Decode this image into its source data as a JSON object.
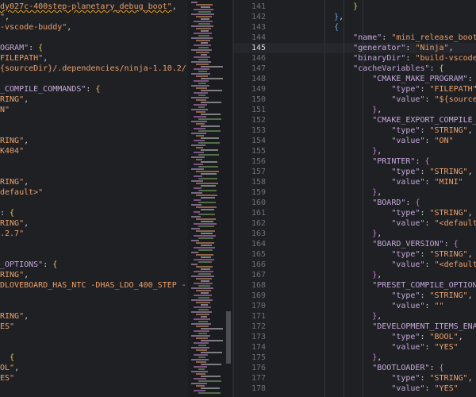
{
  "left_editor": {
    "lines": [
      [
        [
          "s",
          "dy027c-400step-planetary_debug_boot\""
        ],
        [
          "p",
          ","
        ]
      ],
      [
        [
          "s",
          "\""
        ],
        [
          "p",
          ","
        ]
      ],
      [
        [
          "s",
          "-vscode-buddy\""
        ],
        [
          "p",
          ","
        ]
      ],
      [],
      [
        [
          "k",
          "OGRAM\""
        ],
        [
          "p",
          ": "
        ],
        [
          "b1",
          "{"
        ]
      ],
      [
        [
          "s",
          "FILEPATH\""
        ],
        [
          "p",
          ","
        ]
      ],
      [
        [
          "s",
          "{sourceDir}/.dependencies/ninja-1.10.2/"
        ]
      ],
      [],
      [
        [
          "k",
          "_COMPILE_COMMANDS\""
        ],
        [
          "p",
          ": "
        ],
        [
          "b1",
          "{"
        ]
      ],
      [
        [
          "s",
          "RING\""
        ],
        [
          "p",
          ","
        ]
      ],
      [
        [
          "s",
          "N\""
        ]
      ],
      [],
      [],
      [
        [
          "s",
          "RING\""
        ],
        [
          "p",
          ","
        ]
      ],
      [
        [
          "s",
          "K404\""
        ]
      ],
      [],
      [],
      [
        [
          "s",
          "RING\""
        ],
        [
          "p",
          ","
        ]
      ],
      [
        [
          "s",
          "default>\""
        ]
      ],
      [],
      [
        [
          "p",
          ": "
        ],
        [
          "b1",
          "{"
        ]
      ],
      [
        [
          "s",
          "RING\""
        ],
        [
          "p",
          ","
        ]
      ],
      [
        [
          "s",
          ".2.7\""
        ]
      ],
      [],
      [],
      [
        [
          "k",
          "_OPTIONS\""
        ],
        [
          "p",
          ": "
        ],
        [
          "b1",
          "{"
        ]
      ],
      [
        [
          "s",
          "RING\""
        ],
        [
          "p",
          ","
        ]
      ],
      [
        [
          "s",
          "DLOVEBOARD_HAS_NTC -DHAS_LDO_400_STEP -"
        ]
      ],
      [],
      [],
      [
        [
          "s",
          "RING\""
        ],
        [
          "p",
          ","
        ]
      ],
      [
        [
          "s",
          "ES\""
        ]
      ],
      [],
      [],
      [
        [
          "p",
          "  "
        ],
        [
          "b1",
          "{"
        ]
      ],
      [
        [
          "s",
          "OL\""
        ],
        [
          "p",
          ","
        ]
      ],
      [
        [
          "s",
          "ES\""
        ]
      ]
    ]
  },
  "right_editor": {
    "active_line": 145,
    "line_numbers": [
      "141",
      "142",
      "143",
      "144",
      "145",
      "146",
      "147",
      "148",
      "149",
      "150",
      "151",
      "152",
      "153",
      "154",
      "155",
      "156",
      "157",
      "158",
      "159",
      "160",
      "161",
      "162",
      "163",
      "164",
      "165",
      "166",
      "167",
      "168",
      "169",
      "170",
      "171",
      "172",
      "173",
      "174",
      "175",
      "176",
      "177",
      "178"
    ],
    "lines": [
      [
        [
          "b1",
          "        }"
        ]
      ],
      [
        [
          "p",
          "    "
        ],
        [
          "b3",
          "}"
        ],
        [
          "p",
          ","
        ]
      ],
      [
        [
          "p",
          "    "
        ],
        [
          "b3",
          "{"
        ]
      ],
      [
        [
          "p",
          "        "
        ],
        [
          "k",
          "\"name\""
        ],
        [
          "p",
          ": "
        ],
        [
          "s",
          "\"mini_release_boot\""
        ],
        [
          "p",
          ","
        ]
      ],
      [
        [
          "p",
          "        "
        ],
        [
          "k",
          "\"generator\""
        ],
        [
          "p",
          ": "
        ],
        [
          "s",
          "\"Ninja\""
        ],
        [
          "p",
          ","
        ]
      ],
      [
        [
          "p",
          "        "
        ],
        [
          "k",
          "\"binaryDir\""
        ],
        [
          "p",
          ": "
        ],
        [
          "s",
          "\"build-vscode-buddy"
        ]
      ],
      [
        [
          "p",
          "        "
        ],
        [
          "k",
          "\"cacheVariables\""
        ],
        [
          "p",
          ": "
        ],
        [
          "b1",
          "{"
        ]
      ],
      [
        [
          "p",
          "            "
        ],
        [
          "k",
          "\"CMAKE_MAKE_PROGRAM\""
        ],
        [
          "p",
          ": "
        ],
        [
          "b2",
          "{"
        ]
      ],
      [
        [
          "p",
          "                "
        ],
        [
          "k",
          "\"type\""
        ],
        [
          "p",
          ": "
        ],
        [
          "s",
          "\"FILEPATH\""
        ],
        [
          "p",
          ","
        ]
      ],
      [
        [
          "p",
          "                "
        ],
        [
          "k",
          "\"value\""
        ],
        [
          "p",
          ": "
        ],
        [
          "s",
          "\"${sourceDir}/."
        ]
      ],
      [
        [
          "p",
          "            "
        ],
        [
          "b2",
          "}"
        ],
        [
          "p",
          ","
        ]
      ],
      [
        [
          "p",
          "            "
        ],
        [
          "k",
          "\"CMAKE_EXPORT_COMPILE_COMMAND"
        ]
      ],
      [
        [
          "p",
          "                "
        ],
        [
          "k",
          "\"type\""
        ],
        [
          "p",
          ": "
        ],
        [
          "s",
          "\"STRING\""
        ],
        [
          "p",
          ","
        ]
      ],
      [
        [
          "p",
          "                "
        ],
        [
          "k",
          "\"value\""
        ],
        [
          "p",
          ": "
        ],
        [
          "s",
          "\"ON\""
        ]
      ],
      [
        [
          "p",
          "            "
        ],
        [
          "b2",
          "}"
        ],
        [
          "p",
          ","
        ]
      ],
      [
        [
          "p",
          "            "
        ],
        [
          "k",
          "\"PRINTER\""
        ],
        [
          "p",
          ": "
        ],
        [
          "b2",
          "{"
        ]
      ],
      [
        [
          "p",
          "                "
        ],
        [
          "k",
          "\"type\""
        ],
        [
          "p",
          ": "
        ],
        [
          "s",
          "\"STRING\""
        ],
        [
          "p",
          ","
        ]
      ],
      [
        [
          "p",
          "                "
        ],
        [
          "k",
          "\"value\""
        ],
        [
          "p",
          ": "
        ],
        [
          "s",
          "\"MINI\""
        ]
      ],
      [
        [
          "p",
          "            "
        ],
        [
          "b2",
          "}"
        ],
        [
          "p",
          ","
        ]
      ],
      [
        [
          "p",
          "            "
        ],
        [
          "k",
          "\"BOARD\""
        ],
        [
          "p",
          ": "
        ],
        [
          "b2",
          "{"
        ]
      ],
      [
        [
          "p",
          "                "
        ],
        [
          "k",
          "\"type\""
        ],
        [
          "p",
          ": "
        ],
        [
          "s",
          "\"STRING\""
        ],
        [
          "p",
          ","
        ]
      ],
      [
        [
          "p",
          "                "
        ],
        [
          "k",
          "\"value\""
        ],
        [
          "p",
          ": "
        ],
        [
          "s",
          "\"<default>\""
        ]
      ],
      [
        [
          "p",
          "            "
        ],
        [
          "b2",
          "}"
        ],
        [
          "p",
          ","
        ]
      ],
      [
        [
          "p",
          "            "
        ],
        [
          "k",
          "\"BOARD_VERSION\""
        ],
        [
          "p",
          ": "
        ],
        [
          "b2",
          "{"
        ]
      ],
      [
        [
          "p",
          "                "
        ],
        [
          "k",
          "\"type\""
        ],
        [
          "p",
          ": "
        ],
        [
          "s",
          "\"STRING\""
        ],
        [
          "p",
          ","
        ]
      ],
      [
        [
          "p",
          "                "
        ],
        [
          "k",
          "\"value\""
        ],
        [
          "p",
          ": "
        ],
        [
          "s",
          "\"<default>\""
        ]
      ],
      [
        [
          "p",
          "            "
        ],
        [
          "b2",
          "}"
        ],
        [
          "p",
          ","
        ]
      ],
      [
        [
          "p",
          "            "
        ],
        [
          "k",
          "\"PRESET_COMPILE_OPTIONS\""
        ],
        [
          "p",
          ": "
        ],
        [
          "b2",
          "{"
        ]
      ],
      [
        [
          "p",
          "                "
        ],
        [
          "k",
          "\"type\""
        ],
        [
          "p",
          ": "
        ],
        [
          "s",
          "\"STRING\""
        ],
        [
          "p",
          ","
        ]
      ],
      [
        [
          "p",
          "                "
        ],
        [
          "k",
          "\"value\""
        ],
        [
          "p",
          ": "
        ],
        [
          "s",
          "\"\""
        ]
      ],
      [
        [
          "p",
          "            "
        ],
        [
          "b2",
          "}"
        ],
        [
          "p",
          ","
        ]
      ],
      [
        [
          "p",
          "            "
        ],
        [
          "k",
          "\"DEVELOPMENT_ITEMS_ENABLED\""
        ],
        [
          "p",
          ":"
        ]
      ],
      [
        [
          "p",
          "                "
        ],
        [
          "k",
          "\"type\""
        ],
        [
          "p",
          ": "
        ],
        [
          "s",
          "\"BOOL\""
        ],
        [
          "p",
          ","
        ]
      ],
      [
        [
          "p",
          "                "
        ],
        [
          "k",
          "\"value\""
        ],
        [
          "p",
          ": "
        ],
        [
          "s",
          "\"YES\""
        ]
      ],
      [
        [
          "p",
          "            "
        ],
        [
          "b2",
          "}"
        ],
        [
          "p",
          ","
        ]
      ],
      [
        [
          "p",
          "            "
        ],
        [
          "k",
          "\"BOOTLOADER\""
        ],
        [
          "p",
          ": "
        ],
        [
          "b2",
          "{"
        ]
      ],
      [
        [
          "p",
          "                "
        ],
        [
          "k",
          "\"type\""
        ],
        [
          "p",
          ": "
        ],
        [
          "s",
          "\"STRING\""
        ],
        [
          "p",
          ","
        ]
      ],
      [
        [
          "p",
          "                "
        ],
        [
          "k",
          "\"value\""
        ],
        [
          "p",
          ": "
        ],
        [
          "s",
          "\"YES\""
        ]
      ]
    ]
  },
  "colors": {
    "key": "#c4a8d9",
    "string": "#eaa06a",
    "punct": "#d1d2d6",
    "bracket_1": "#e6c75a",
    "bracket_2": "#d07fd8",
    "bracket_3": "#5fa6e8"
  }
}
